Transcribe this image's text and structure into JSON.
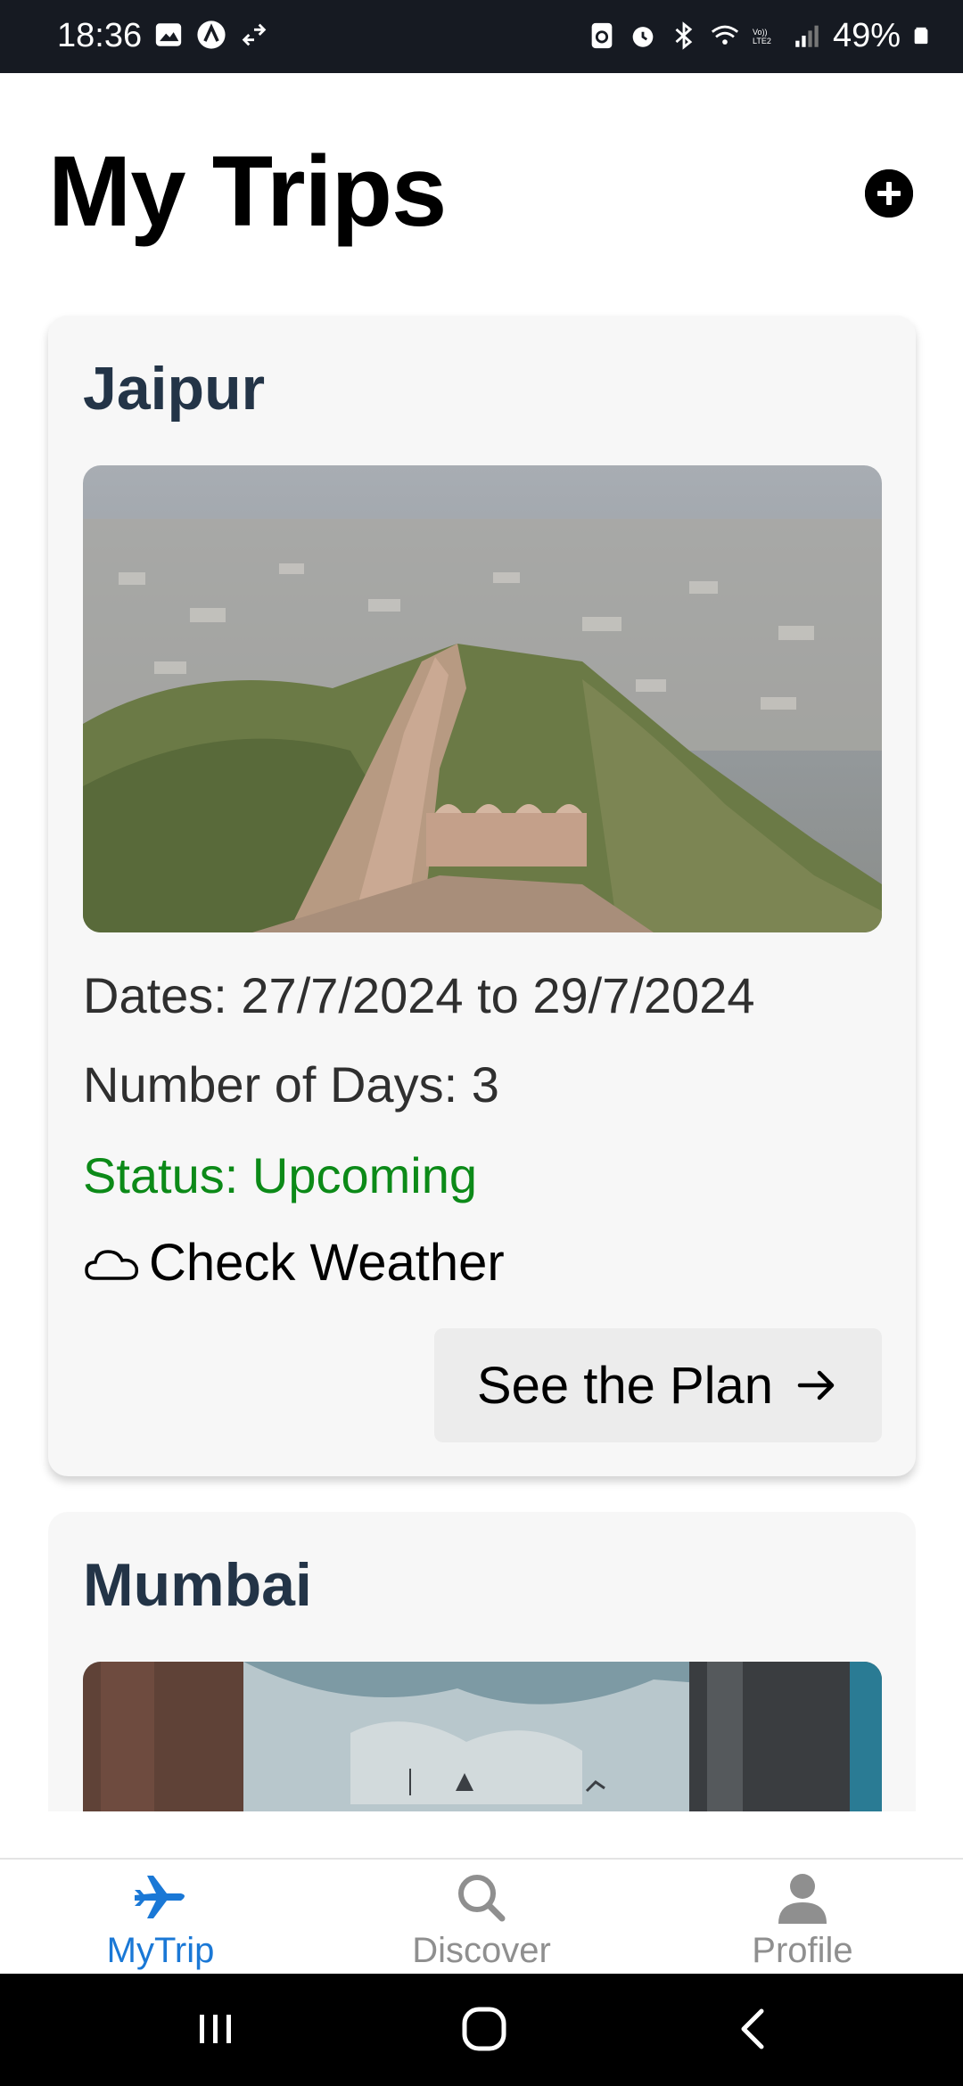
{
  "status_bar": {
    "time": "18:36",
    "battery_percent": "49%",
    "network_label": "Vo)) LTE2"
  },
  "header": {
    "title": "My Trips",
    "add_icon": "plus-circle-icon"
  },
  "trips": [
    {
      "city": "Jaipur",
      "image_alt": "Fort wall overlooking Jaipur city",
      "dates": "Dates: 27/7/2024 to 29/7/2024",
      "days": "Number of Days: 3",
      "status": "Status: Upcoming",
      "weather_label": "Check Weather",
      "plan_label": "See the Plan"
    },
    {
      "city": "Mumbai",
      "image_alt": "Mumbai landmark under cloudy sky"
    }
  ],
  "bottom_nav": {
    "items": [
      {
        "label": "MyTrip",
        "icon": "airplane-icon",
        "active": true
      },
      {
        "label": "Discover",
        "icon": "search-icon",
        "active": false
      },
      {
        "label": "Profile",
        "icon": "person-icon",
        "active": false
      }
    ]
  },
  "colors": {
    "accent": "#1a78d6",
    "status_upcoming": "#0c8a18",
    "city_title": "#233447",
    "card_bg": "#f7f7f7"
  }
}
